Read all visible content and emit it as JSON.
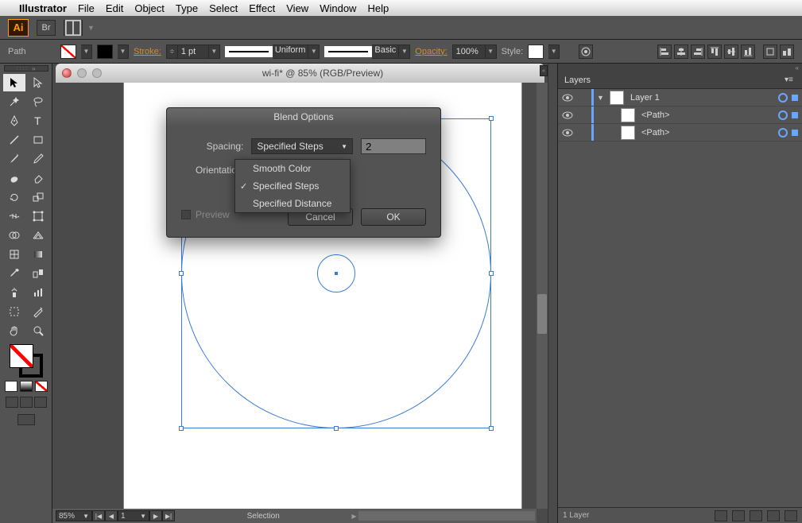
{
  "menubar": {
    "app": "Illustrator",
    "items": [
      "File",
      "Edit",
      "Object",
      "Type",
      "Select",
      "Effect",
      "View",
      "Window",
      "Help"
    ]
  },
  "control": {
    "selection_label": "Path",
    "stroke_label": "Stroke:",
    "stroke_weight": "1 pt",
    "profile": "Uniform",
    "brush": "Basic",
    "opacity_label": "Opacity:",
    "opacity_value": "100%",
    "style_label": "Style:"
  },
  "document": {
    "title": "wi-fi* @ 85% (RGB/Preview)",
    "zoom": "85%",
    "page": "1",
    "status_tool": "Selection"
  },
  "dialog": {
    "title": "Blend Options",
    "spacing_label": "Spacing:",
    "spacing_value": "Specified Steps",
    "steps": "2",
    "orientation_label": "Orientation:",
    "preview_label": "Preview",
    "cancel": "Cancel",
    "ok": "OK",
    "options": {
      "smooth": "Smooth Color",
      "steps": "Specified Steps",
      "distance": "Specified Distance"
    }
  },
  "layers": {
    "panel_label": "Layers",
    "layer1": "Layer 1",
    "path_label": "<Path>",
    "footer": "1 Layer"
  }
}
